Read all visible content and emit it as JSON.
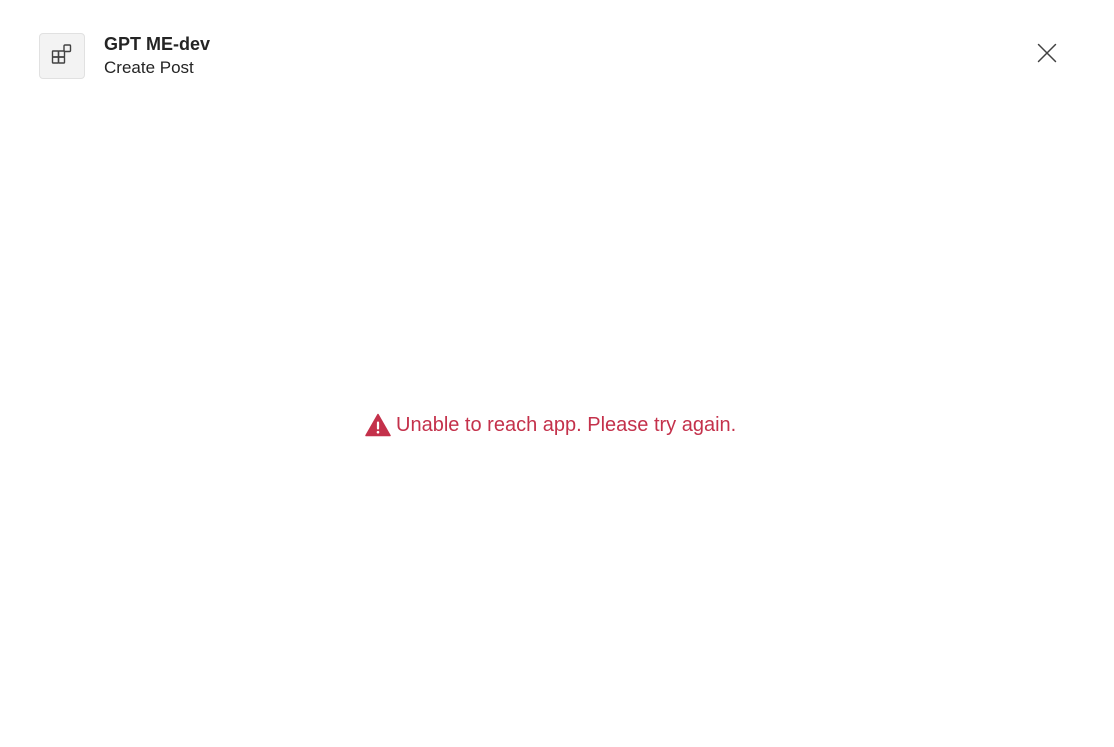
{
  "app": {
    "name": "GPT ME-dev",
    "subtitle": "Create Post",
    "icon": "apps-icon"
  },
  "close_icon": "close-icon",
  "error": {
    "message": "Unable to reach app. Please try again.",
    "icon": "warning-icon",
    "color": "#c4314b"
  }
}
